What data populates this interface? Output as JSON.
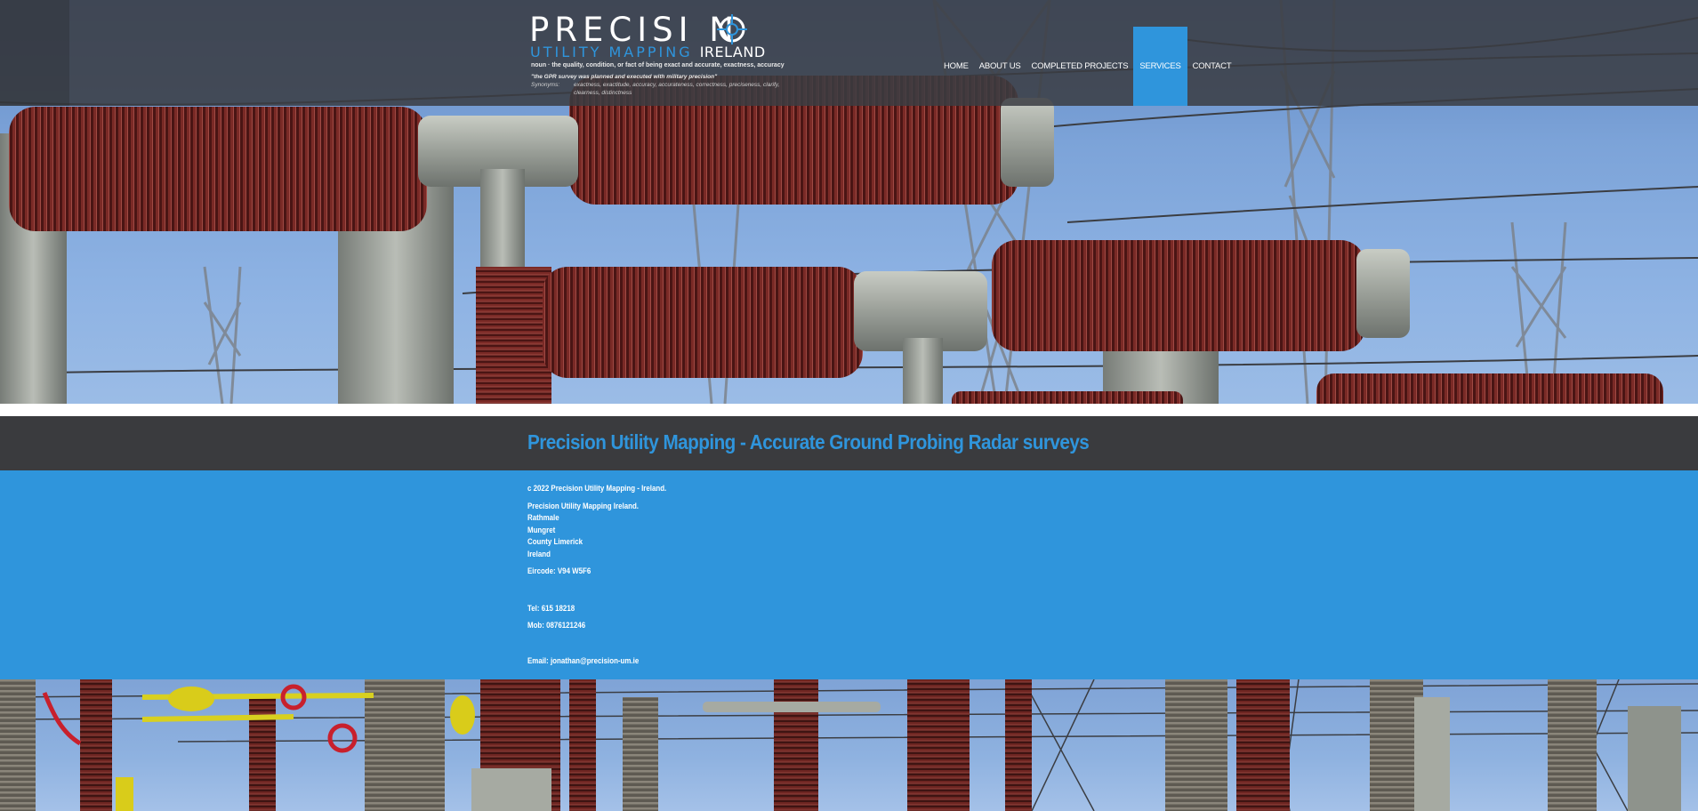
{
  "brand": {
    "name_main": "PRECISI N",
    "name_sub_blue": "UTILITY MAPPING",
    "name_sub_white": "IRELAND",
    "definition": "noun · the quality, condition, or fact of being exact and accurate, exactness, accuracy",
    "example": "\"the GPR survey was planned and executed with military precision\"",
    "synonyms_label": "Synonyms:",
    "synonyms_1": "exactness, exactitude, accuracy, accurateness, correctness, preciseness, clarify,",
    "synonyms_2": "clearness, distinctness"
  },
  "nav": {
    "items": [
      {
        "label": "HOME"
      },
      {
        "label": "ABOUT US"
      },
      {
        "label": "COMPLETED PROJECTS"
      },
      {
        "label": "SERVICES"
      },
      {
        "label": "CONTACT"
      }
    ],
    "active_index": 3
  },
  "page": {
    "title": "Precision Utility Mapping - Accurate Ground Probing Radar surveys"
  },
  "footer": {
    "copyright": "c 2022 Precision Utility Mapping - Ireland.",
    "address": [
      "Precision Utility Mapping Ireland.",
      "Rathmale",
      "Mungret",
      "County Limerick",
      "Ireland"
    ],
    "eircode": "Eircode: V94 W5F6",
    "tel": "Tel: 615 18218",
    "mob": "Mob: 0876121246",
    "email": "Email: jonathan@precision-um.ie"
  },
  "colors": {
    "accent_blue": "#2f95dc",
    "header_bg": "#3a3c42",
    "title_bar_bg": "#3a3b3e"
  }
}
